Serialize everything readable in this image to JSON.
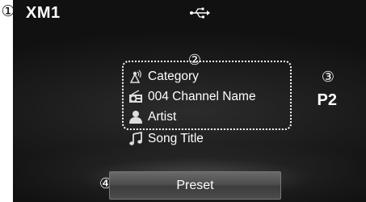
{
  "header": {
    "source": "XM1",
    "usb_icon": "usb-icon"
  },
  "callouts": {
    "c1": "①",
    "c2": "②",
    "c3": "③",
    "c4": "④"
  },
  "info": {
    "category": "Category",
    "channel": "004 Channel Name",
    "artist": "Artist",
    "song": "Song Title",
    "icons": [
      "category-icon",
      "channel-icon",
      "artist-icon",
      "song-icon"
    ]
  },
  "preset": {
    "number": "P2",
    "button_label": "Preset"
  },
  "colors": {
    "background": "#1b1b1b",
    "text": "#ffffff",
    "button": "#4a4a4a"
  }
}
